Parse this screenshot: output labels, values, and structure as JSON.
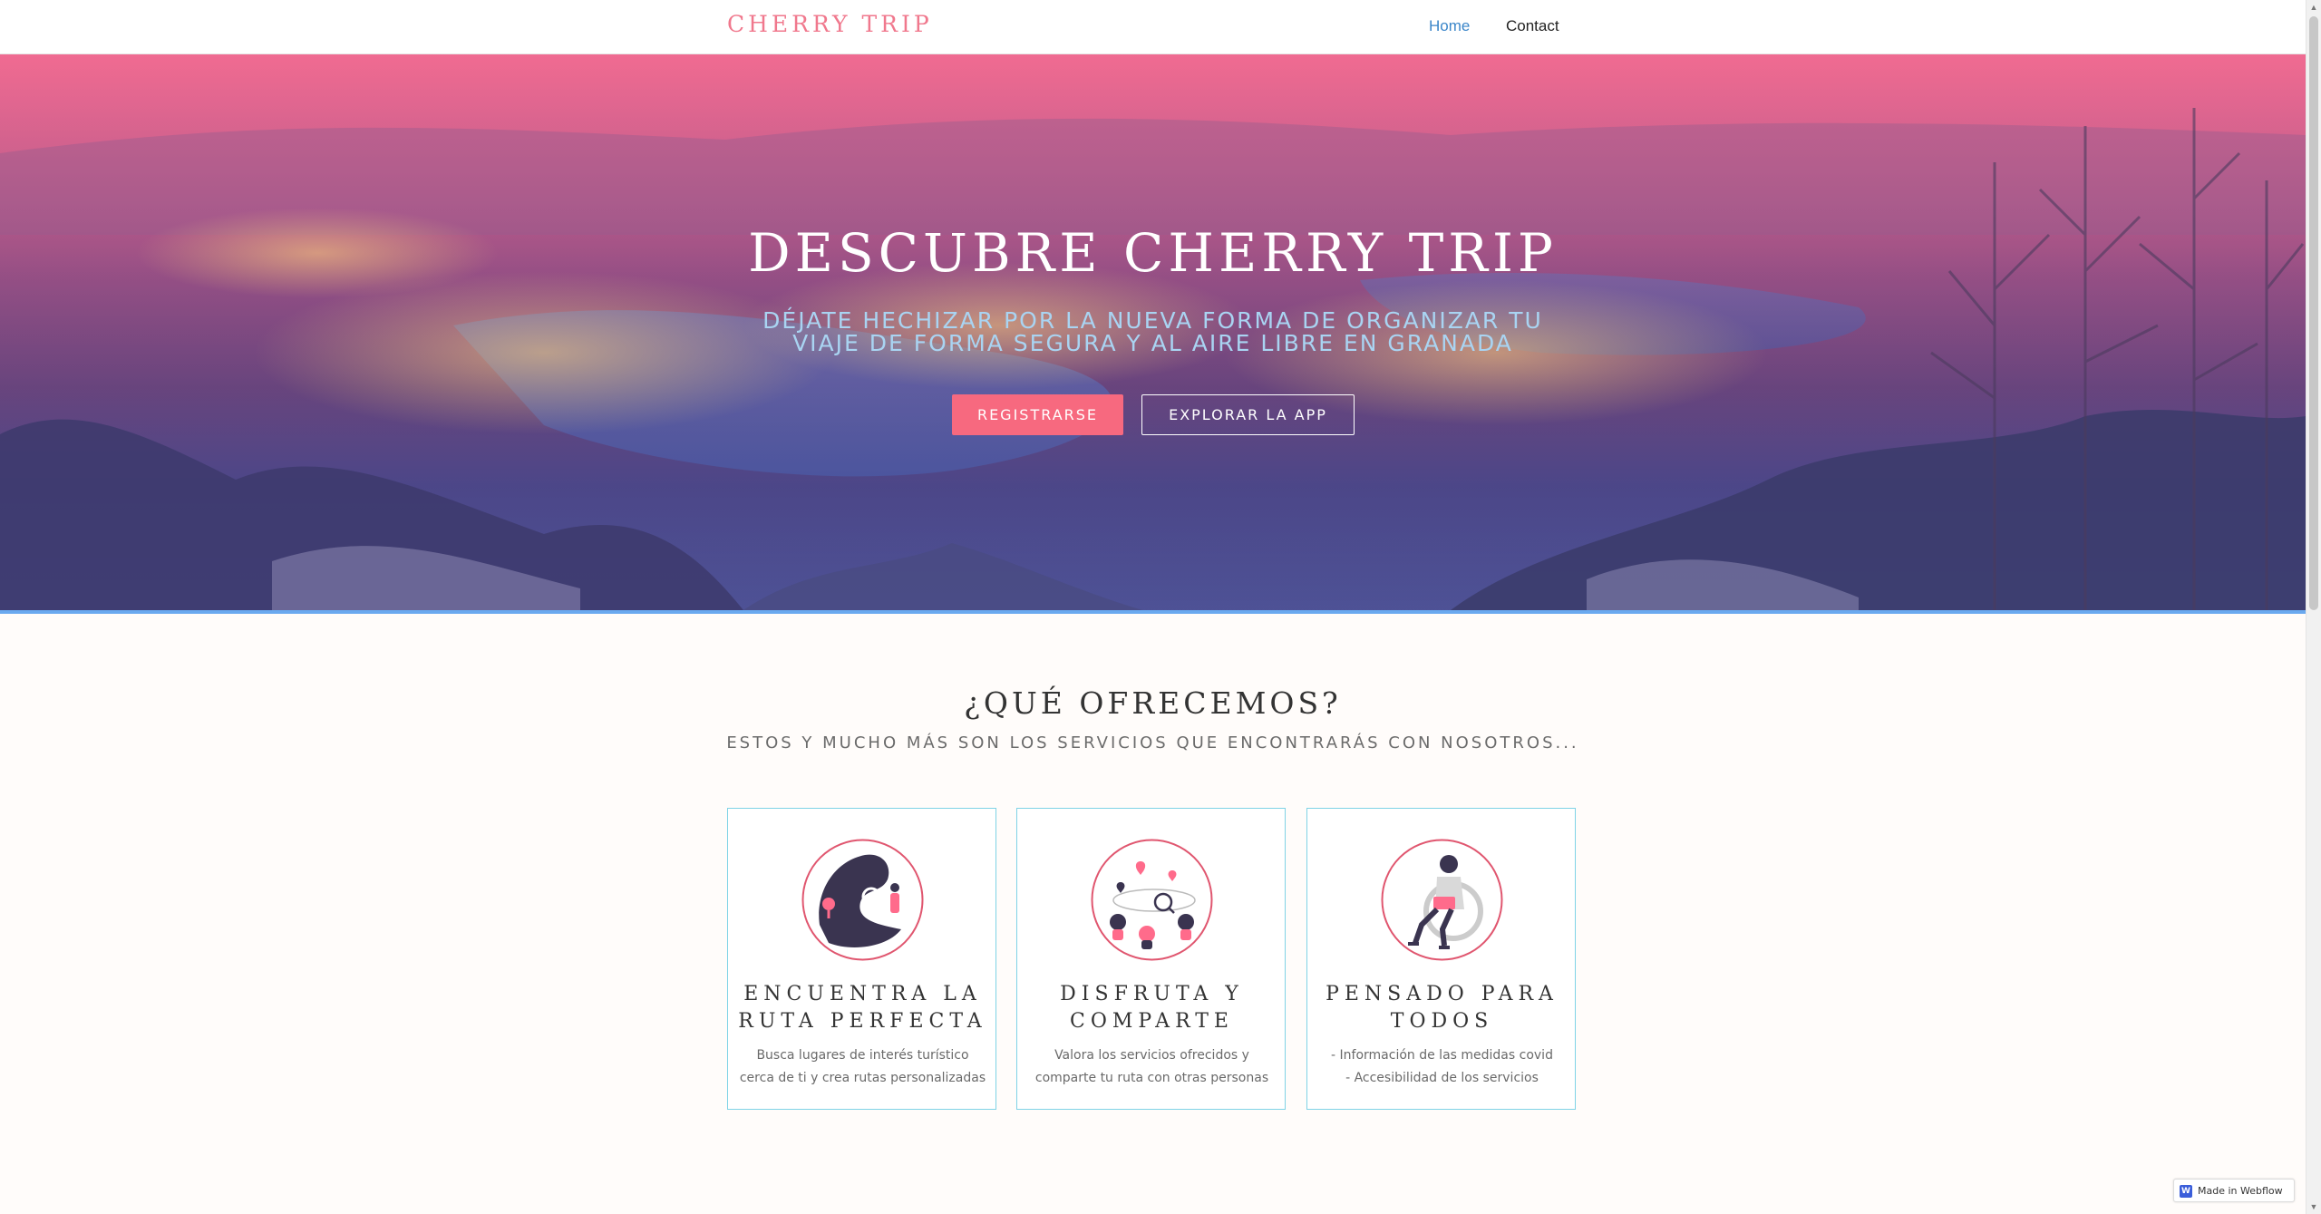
{
  "navbar": {
    "brand": "CHERRY TRIP",
    "links": [
      {
        "label": "Home",
        "active": true
      },
      {
        "label": "Contact",
        "active": false
      }
    ]
  },
  "hero": {
    "title": "DESCUBRE CHERRY TRIP",
    "subtitle": "DÉJATE HECHIZAR POR LA NUEVA FORMA DE ORGANIZAR TU VIAJE DE FORMA SEGURA Y AL AIRE LIBRE EN GRANADA",
    "primary_button": "REGISTRARSE",
    "secondary_button": "EXPLORAR LA APP"
  },
  "services": {
    "title": "¿QUÉ OFRECEMOS?",
    "subtitle": "ESTOS Y MUCHO MÁS SON LOS SERVICIOS QUE ENCONTRARÁS CON NOSOTROS...",
    "cards": [
      {
        "title": "ENCUENTRA LA RUTA PERFECTA",
        "description": "Busca lugares de interés turístico cerca de ti y crea rutas personalizadas",
        "icon": "map-search-icon"
      },
      {
        "title": "DISFRUTA Y COMPARTE",
        "description": "Valora los servicios ofrecidos y comparte tu ruta con otras personas",
        "icon": "share-route-icon"
      },
      {
        "title": "PENSADO PARA TODOS",
        "description": "- Información de las medidas covid\n- Accesibilidad de los servicios",
        "icon": "accessibility-icon"
      }
    ]
  },
  "badge": {
    "label": "Made in Webflow",
    "logo": "W"
  },
  "colors": {
    "brand": "#f0788d",
    "accent_button": "#f7697f",
    "nav_active": "#3b86c9",
    "card_border": "#7fd3e6",
    "hero_subtitle": "#a9d4f2"
  }
}
